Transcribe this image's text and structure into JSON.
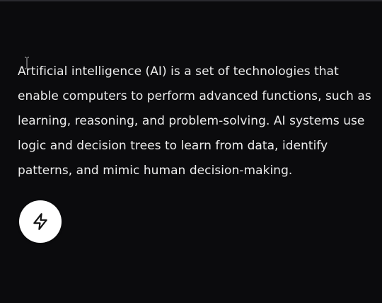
{
  "content": {
    "paragraph": "Artificial intelligence (AI) is a set of technologies that enable computers to perform advanced functions, such as learning, reasoning, and problem-solving. AI systems use logic and decision trees to learn from data, identify patterns, and mimic human decision-making."
  },
  "action_button": {
    "icon": "lightning-icon"
  },
  "colors": {
    "background": "#0b0b0d",
    "text": "#ececec",
    "button_bg": "#ffffff",
    "icon_stroke": "#111111"
  }
}
